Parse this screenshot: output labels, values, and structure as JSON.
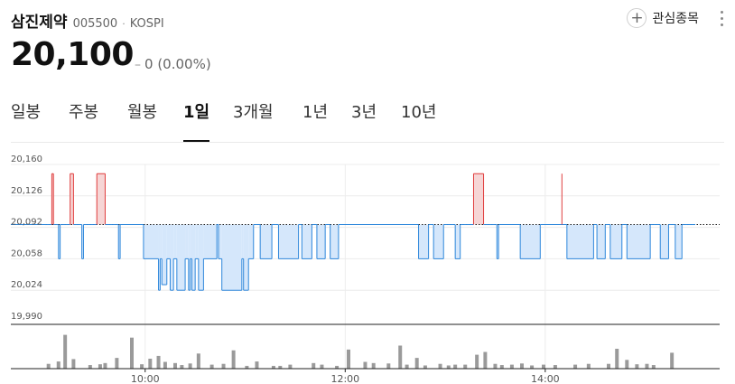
{
  "header": {
    "name": "삼진제약",
    "code": "005500",
    "separator": "·",
    "market": "KOSPI",
    "favorite_label": "관심종목"
  },
  "quote": {
    "price": "20,100",
    "change": "0",
    "change_pct": "(0.00%)"
  },
  "tabs": [
    {
      "label": "일봉"
    },
    {
      "label": "주봉"
    },
    {
      "label": "월봉"
    },
    {
      "label": "1일",
      "active": true
    },
    {
      "label": "3개월"
    },
    {
      "label": "1년"
    },
    {
      "label": "3년"
    },
    {
      "label": "10년"
    }
  ],
  "chart_data": {
    "type": "area",
    "reference": 20095,
    "ylim": [
      19990,
      20160
    ],
    "y_ticks": [
      "20,160",
      "20,126",
      "20,092",
      "20,058",
      "20,024",
      "19,990"
    ],
    "y_tick_values": [
      20160,
      20126,
      20092,
      20058,
      20024,
      19990
    ],
    "x_ticks": [
      {
        "label": "10:00",
        "x": 60
      },
      {
        "label": "12:00",
        "x": 180
      },
      {
        "label": "14:00",
        "x": 300
      }
    ],
    "x_range": [
      0,
      390
    ],
    "price_series": [
      [
        0,
        20095
      ],
      [
        4,
        20095
      ],
      [
        4,
        20150
      ],
      [
        5,
        20150
      ],
      [
        5,
        20095
      ],
      [
        8,
        20095
      ],
      [
        8,
        20058
      ],
      [
        9,
        20058
      ],
      [
        9,
        20095
      ],
      [
        15,
        20095
      ],
      [
        15,
        20150
      ],
      [
        17,
        20150
      ],
      [
        17,
        20095
      ],
      [
        22,
        20095
      ],
      [
        22,
        20058
      ],
      [
        23,
        20058
      ],
      [
        23,
        20095
      ],
      [
        31,
        20095
      ],
      [
        31,
        20150
      ],
      [
        36,
        20150
      ],
      [
        36,
        20095
      ],
      [
        44,
        20095
      ],
      [
        44,
        20058
      ],
      [
        45,
        20058
      ],
      [
        45,
        20095
      ],
      [
        59,
        20095
      ],
      [
        59,
        20058
      ],
      [
        68,
        20058
      ],
      [
        68,
        20024
      ],
      [
        69,
        20024
      ],
      [
        69,
        20058
      ],
      [
        70,
        20058
      ],
      [
        70,
        20030
      ],
      [
        73,
        20030
      ],
      [
        73,
        20058
      ],
      [
        75,
        20058
      ],
      [
        75,
        20024
      ],
      [
        77,
        20024
      ],
      [
        77,
        20058
      ],
      [
        79,
        20058
      ],
      [
        79,
        20024
      ],
      [
        84,
        20024
      ],
      [
        84,
        20058
      ],
      [
        86,
        20058
      ],
      [
        86,
        20024
      ],
      [
        87,
        20024
      ],
      [
        87,
        20058
      ],
      [
        88,
        20058
      ],
      [
        88,
        20024
      ],
      [
        90,
        20024
      ],
      [
        90,
        20058
      ],
      [
        92,
        20058
      ],
      [
        92,
        20024
      ],
      [
        95,
        20024
      ],
      [
        95,
        20058
      ],
      [
        103,
        20058
      ],
      [
        103,
        20095
      ],
      [
        104,
        20095
      ],
      [
        104,
        20058
      ],
      [
        106,
        20058
      ],
      [
        106,
        20024
      ],
      [
        118,
        20024
      ],
      [
        118,
        20058
      ],
      [
        119,
        20058
      ],
      [
        119,
        20024
      ],
      [
        122,
        20024
      ],
      [
        122,
        20058
      ],
      [
        125,
        20058
      ],
      [
        125,
        20095
      ],
      [
        129,
        20095
      ],
      [
        129,
        20058
      ],
      [
        136,
        20058
      ],
      [
        136,
        20095
      ],
      [
        140,
        20095
      ],
      [
        140,
        20058
      ],
      [
        152,
        20058
      ],
      [
        152,
        20095
      ],
      [
        154,
        20095
      ],
      [
        154,
        20058
      ],
      [
        160,
        20058
      ],
      [
        160,
        20095
      ],
      [
        163,
        20095
      ],
      [
        163,
        20058
      ],
      [
        168,
        20058
      ],
      [
        168,
        20095
      ],
      [
        171,
        20095
      ],
      [
        171,
        20058
      ],
      [
        176,
        20058
      ],
      [
        176,
        20095
      ],
      [
        224,
        20095
      ],
      [
        224,
        20058
      ],
      [
        230,
        20058
      ],
      [
        230,
        20095
      ],
      [
        233,
        20095
      ],
      [
        233,
        20058
      ],
      [
        239,
        20058
      ],
      [
        239,
        20095
      ],
      [
        246,
        20095
      ],
      [
        246,
        20058
      ],
      [
        249,
        20058
      ],
      [
        249,
        20095
      ],
      [
        257,
        20095
      ],
      [
        257,
        20150
      ],
      [
        263,
        20150
      ],
      [
        263,
        20095
      ],
      [
        271,
        20095
      ],
      [
        271,
        20058
      ],
      [
        272,
        20058
      ],
      [
        272,
        20095
      ],
      [
        285,
        20095
      ],
      [
        285,
        20058
      ],
      [
        297,
        20058
      ],
      [
        297,
        20095
      ],
      [
        313,
        20095
      ],
      [
        313,
        20058
      ],
      [
        329,
        20058
      ],
      [
        329,
        20095
      ],
      [
        331,
        20095
      ],
      [
        331,
        20058
      ],
      [
        336,
        20058
      ],
      [
        336,
        20095
      ],
      [
        339,
        20095
      ],
      [
        339,
        20058
      ],
      [
        346,
        20058
      ],
      [
        346,
        20095
      ],
      [
        349,
        20095
      ],
      [
        349,
        20058
      ],
      [
        363,
        20058
      ],
      [
        363,
        20095
      ],
      [
        369,
        20095
      ],
      [
        369,
        20058
      ],
      [
        374,
        20058
      ],
      [
        374,
        20095
      ],
      [
        378,
        20095
      ],
      [
        378,
        20058
      ],
      [
        382,
        20058
      ],
      [
        382,
        20095
      ],
      [
        390,
        20095
      ]
    ],
    "spikes": [
      {
        "x": 310,
        "y": 20150
      }
    ],
    "volume_series": [
      [
        2,
        12
      ],
      [
        8,
        18
      ],
      [
        12,
        85
      ],
      [
        17,
        24
      ],
      [
        27,
        9
      ],
      [
        33,
        11
      ],
      [
        36,
        14
      ],
      [
        43,
        27
      ],
      [
        52,
        78
      ],
      [
        58,
        11
      ],
      [
        63,
        25
      ],
      [
        68,
        32
      ],
      [
        72,
        17
      ],
      [
        78,
        14
      ],
      [
        82,
        9
      ],
      [
        87,
        13
      ],
      [
        92,
        38
      ],
      [
        100,
        10
      ],
      [
        107,
        12
      ],
      [
        113,
        46
      ],
      [
        121,
        7
      ],
      [
        127,
        18
      ],
      [
        137,
        7
      ],
      [
        141,
        7
      ],
      [
        147,
        10
      ],
      [
        161,
        14
      ],
      [
        166,
        10
      ],
      [
        175,
        7
      ],
      [
        182,
        48
      ],
      [
        192,
        17
      ],
      [
        197,
        14
      ],
      [
        206,
        13
      ],
      [
        213,
        58
      ],
      [
        217,
        10
      ],
      [
        223,
        27
      ],
      [
        228,
        8
      ],
      [
        237,
        12
      ],
      [
        242,
        8
      ],
      [
        246,
        10
      ],
      [
        252,
        10
      ],
      [
        259,
        35
      ],
      [
        264,
        42
      ],
      [
        270,
        12
      ],
      [
        274,
        9
      ],
      [
        280,
        10
      ],
      [
        286,
        13
      ],
      [
        292,
        8
      ],
      [
        299,
        10
      ],
      [
        306,
        9
      ],
      [
        318,
        10
      ],
      [
        326,
        12
      ],
      [
        338,
        12
      ],
      [
        343,
        50
      ],
      [
        349,
        22
      ],
      [
        355,
        11
      ],
      [
        361,
        12
      ],
      [
        365,
        9
      ],
      [
        376,
        40
      ]
    ],
    "volume_max": 100,
    "colors": {
      "down_line": "#2e87db",
      "down_fill": "#d5e7fb",
      "up_line": "#e03c3c",
      "up_fill": "#f6d5d5",
      "volume": "#9a9a9a",
      "grid": "#ececec",
      "reference_line": "#222222"
    }
  }
}
